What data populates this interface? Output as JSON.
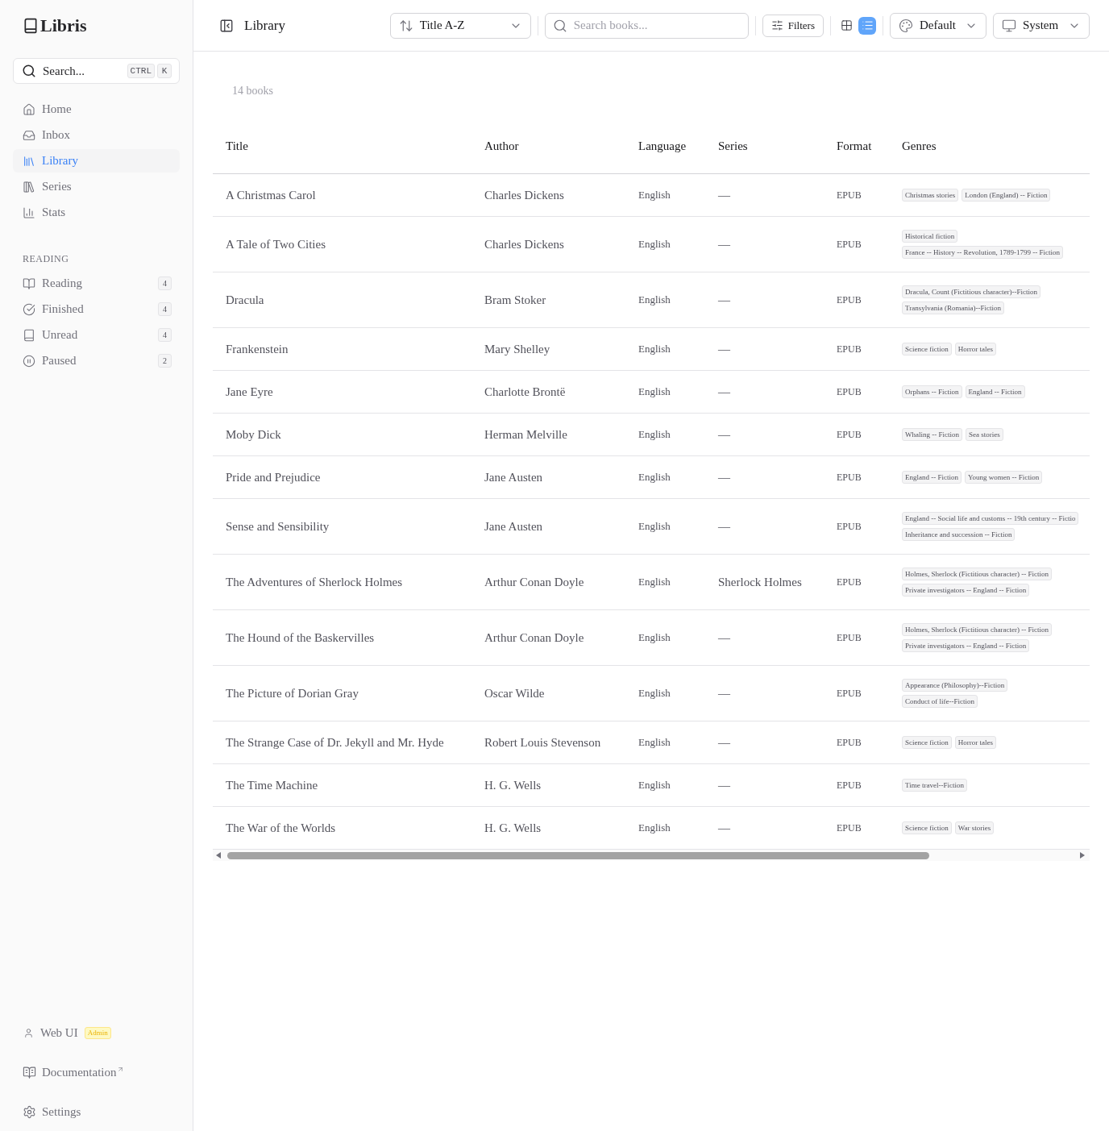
{
  "sidebar": {
    "logo": "Libris",
    "search": {
      "label": "Search...",
      "shortcut": [
        "CTRL",
        "K"
      ]
    },
    "nav": [
      {
        "label": "Home",
        "selected": false
      },
      {
        "label": "Inbox",
        "selected": false
      },
      {
        "label": "Library",
        "selected": true
      },
      {
        "label": "Series",
        "selected": false
      },
      {
        "label": "Stats",
        "selected": false
      }
    ],
    "section_title": "READING",
    "reading": [
      {
        "label": "Reading",
        "count": "4",
        "selected": false
      },
      {
        "label": "Finished",
        "count": "4",
        "selected": false
      },
      {
        "label": "Unread",
        "count": "4",
        "selected": false
      },
      {
        "label": "Paused",
        "count": "2",
        "selected": false
      }
    ],
    "footer": [
      {
        "label": "Web UI",
        "badge": "Admin"
      },
      {
        "label": "Documentation",
        "external": true
      },
      {
        "label": "Settings"
      }
    ]
  },
  "header": {
    "title": "Library",
    "sort": "Title A-Z",
    "search": {
      "placeholder": "Search books..."
    },
    "filters": "Filters",
    "view_toggle": [
      {
        "kind": "grid",
        "selected": false
      },
      {
        "kind": "list",
        "selected": true
      }
    ],
    "theme": "Default",
    "mode": "System"
  },
  "count": "14 books",
  "table": {
    "columns": [
      "Title",
      "Author",
      "Language",
      "Series",
      "Format",
      "Genres"
    ],
    "rows": [
      {
        "title": "A Christmas Carol",
        "author": "Charles Dickens",
        "language": "English",
        "series": "—",
        "format": "EPUB",
        "genres": [
          "Christmas stories",
          "London (England) -- Fiction"
        ]
      },
      {
        "title": "A Tale of Two Cities",
        "author": "Charles Dickens",
        "language": "English",
        "series": "—",
        "format": "EPUB",
        "genres": [
          "Historical fiction",
          "France -- History -- Revolution, 1789-1799 -- Fiction"
        ]
      },
      {
        "title": "Dracula",
        "author": "Bram Stoker",
        "language": "English",
        "series": "—",
        "format": "EPUB",
        "genres": [
          "Dracula, Count (Fictitious character)--Fiction",
          "Transylvania (Romania)--Fiction"
        ]
      },
      {
        "title": "Frankenstein",
        "author": "Mary Shelley",
        "language": "English",
        "series": "—",
        "format": "EPUB",
        "genres": [
          "Science fiction",
          "Horror tales"
        ]
      },
      {
        "title": "Jane Eyre",
        "author": "Charlotte Brontë",
        "language": "English",
        "series": "—",
        "format": "EPUB",
        "genres": [
          "Orphans -- Fiction",
          "England -- Fiction"
        ]
      },
      {
        "title": "Moby Dick",
        "author": "Herman Melville",
        "language": "English",
        "series": "—",
        "format": "EPUB",
        "genres": [
          "Whaling -- Fiction",
          "Sea stories"
        ]
      },
      {
        "title": "Pride and Prejudice",
        "author": "Jane Austen",
        "language": "English",
        "series": "—",
        "format": "EPUB",
        "genres": [
          "England -- Fiction",
          "Young women -- Fiction"
        ]
      },
      {
        "title": "Sense and Sensibility",
        "author": "Jane Austen",
        "language": "English",
        "series": "—",
        "format": "EPUB",
        "genres": [
          "England -- Social life and customs -- 19th century -- Fictio",
          "Inheritance and succession -- Fiction"
        ]
      },
      {
        "title": "The Adventures of Sherlock Holmes",
        "author": "Arthur Conan Doyle",
        "language": "English",
        "series": "Sherlock Holmes",
        "format": "EPUB",
        "genres": [
          "Holmes, Sherlock (Fictitious character) -- Fiction",
          "Private investigators -- England -- Fiction"
        ]
      },
      {
        "title": "The Hound of the Baskervilles",
        "author": "Arthur Conan Doyle",
        "language": "English",
        "series": "—",
        "format": "EPUB",
        "genres": [
          "Holmes, Sherlock (Fictitious character) -- Fiction",
          "Private investigators -- England -- Fiction"
        ]
      },
      {
        "title": "The Picture of Dorian Gray",
        "author": "Oscar Wilde",
        "language": "English",
        "series": "—",
        "format": "EPUB",
        "genres": [
          "Appearance (Philosophy)--Fiction",
          "Conduct of life--Fiction"
        ]
      },
      {
        "title": "The Strange Case of Dr. Jekyll and Mr. Hyde",
        "author": "Robert Louis Stevenson",
        "language": "English",
        "series": "—",
        "format": "EPUB",
        "genres": [
          "Science fiction",
          "Horror tales"
        ]
      },
      {
        "title": "The Time Machine",
        "author": "H. G. Wells",
        "language": "English",
        "series": "—",
        "format": "EPUB",
        "genres": [
          "Time travel--Fiction"
        ]
      },
      {
        "title": "The War of the Worlds",
        "author": "H. G. Wells",
        "language": "English",
        "series": "—",
        "format": "EPUB",
        "genres": [
          "Science fiction",
          "War stories"
        ]
      }
    ]
  }
}
